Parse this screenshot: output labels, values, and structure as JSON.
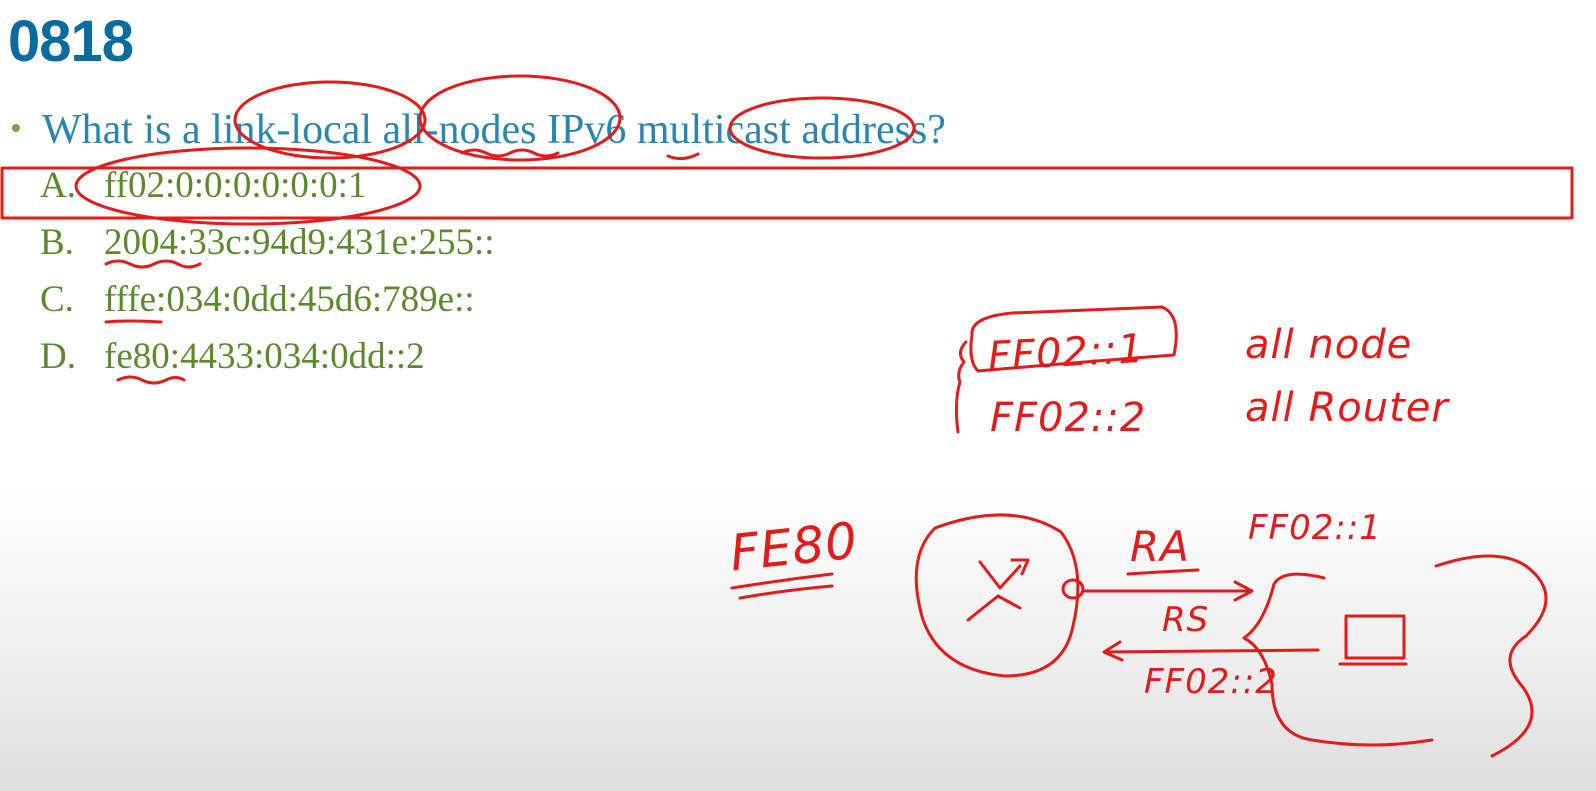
{
  "slide": {
    "title": "0818",
    "question": "What is a link-local all-nodes IPv6 multicast address?"
  },
  "options": [
    {
      "letter": "A.",
      "text": "ff02:0:0:0:0:0:0:1"
    },
    {
      "letter": "B.",
      "text": "2004:33c:94d9:431e:255::"
    },
    {
      "letter": "C.",
      "text": "fffe:034:0dd:45d6:789e::"
    },
    {
      "letter": "D.",
      "text": "fe80:4433:034:0dd::2"
    }
  ],
  "annotations": {
    "ff02_1": "FF02::1",
    "all_node": "all node",
    "ff02_2": "FF02::2",
    "all_router": "all Router",
    "fe80": "FE80",
    "ra": "RA",
    "ra_addr": "FF02::1",
    "rs": "RS",
    "rs_addr": "FF02::2"
  },
  "colors": {
    "title": "#0b6b9e",
    "question": "#2a86b0",
    "options": "#5a8a2c",
    "ink": "#e21b1b"
  }
}
